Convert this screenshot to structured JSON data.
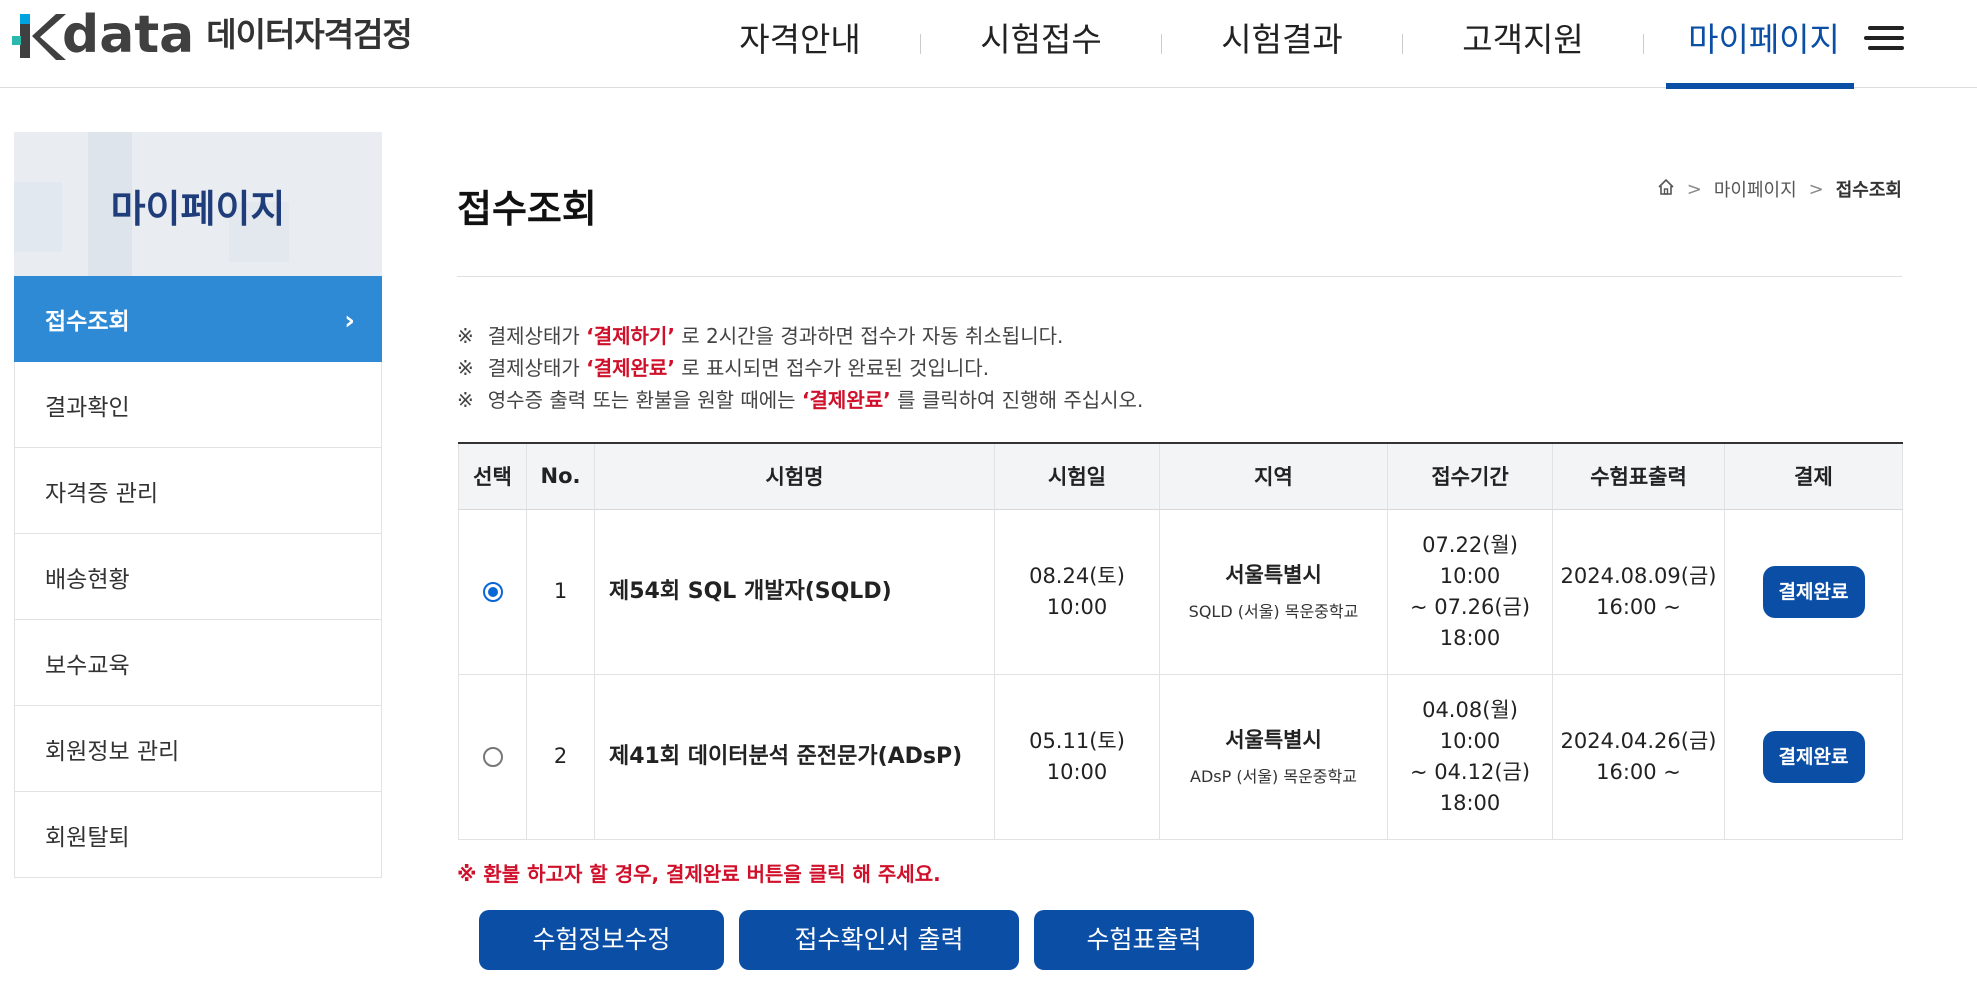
{
  "header": {
    "logo_text": "data",
    "logo_subtitle": "데이터자격검정",
    "nav": [
      {
        "label": "자격안내"
      },
      {
        "label": "시험접수"
      },
      {
        "label": "시험결과"
      },
      {
        "label": "고객지원"
      },
      {
        "label": "마이페이지",
        "active": true
      }
    ],
    "menu_icon": "hamburger-icon"
  },
  "sidebar": {
    "title": "마이페이지",
    "items": [
      {
        "label": "접수조회",
        "active": true
      },
      {
        "label": "결과확인"
      },
      {
        "label": "자격증 관리"
      },
      {
        "label": "배송현황"
      },
      {
        "label": "보수교육"
      },
      {
        "label": "회원정보 관리"
      },
      {
        "label": "회원탈퇴"
      }
    ]
  },
  "main": {
    "title": "접수조회",
    "breadcrumb": [
      "마이페이지",
      "접수조회"
    ],
    "notes": [
      {
        "mark": "※",
        "pre": "결제상태가 ",
        "hl": "‘결제하기’",
        "post": " 로 2시간을 경과하면 접수가 자동 취소됩니다."
      },
      {
        "mark": "※",
        "pre": "결제상태가 ",
        "hl": "‘결제완료’",
        "post": " 로 표시되면 접수가 완료된 것입니다."
      },
      {
        "mark": "※",
        "pre": "영수증 출력 또는 환불을 원할 때에는 ",
        "hl": "‘결제완료’",
        "post": " 를 클릭하여 진행해 주십시오."
      }
    ],
    "table": {
      "headers": [
        "선택",
        "No.",
        "시험명",
        "시험일",
        "지역",
        "접수기간",
        "수험표출력",
        "결제"
      ],
      "rows": [
        {
          "selected": true,
          "no": "1",
          "exam_name": "제54회 SQL 개발자(SQLD)",
          "exam_date": "08.24(토)",
          "exam_time": "10:00",
          "region": "서울특별시",
          "venue": "SQLD (서울) 목운중학교",
          "period_start_date": "07.22(월)",
          "period_start_time": "10:00",
          "period_end_date": "~ 07.26(금)",
          "period_end_time": "18:00",
          "ticket_date": "2024.08.09(금)",
          "ticket_time": "16:00 ~",
          "payment_status": "결제완료"
        },
        {
          "selected": false,
          "no": "2",
          "exam_name": "제41회 데이터분석 준전문가(ADsP)",
          "exam_date": "05.11(토)",
          "exam_time": "10:00",
          "region": "서울특별시",
          "venue": "ADsP (서울) 목운중학교",
          "period_start_date": "04.08(월)",
          "period_start_time": "10:00",
          "period_end_date": "~ 04.12(금)",
          "period_end_time": "18:00",
          "ticket_date": "2024.04.26(금)",
          "ticket_time": "16:00 ~",
          "payment_status": "결제완료"
        }
      ]
    },
    "refund_note": "※ 환불 하고자 할 경우, 결제완료 버튼을 클릭 해 주세요.",
    "buttons": {
      "edit_info": "수험정보수정",
      "print_receipt": "접수확인서 출력",
      "print_ticket": "수험표출력"
    }
  },
  "colors": {
    "brand_blue": "#0a4ea6",
    "sidebar_active": "#2f8ad6",
    "alert_red": "#d0102b"
  }
}
